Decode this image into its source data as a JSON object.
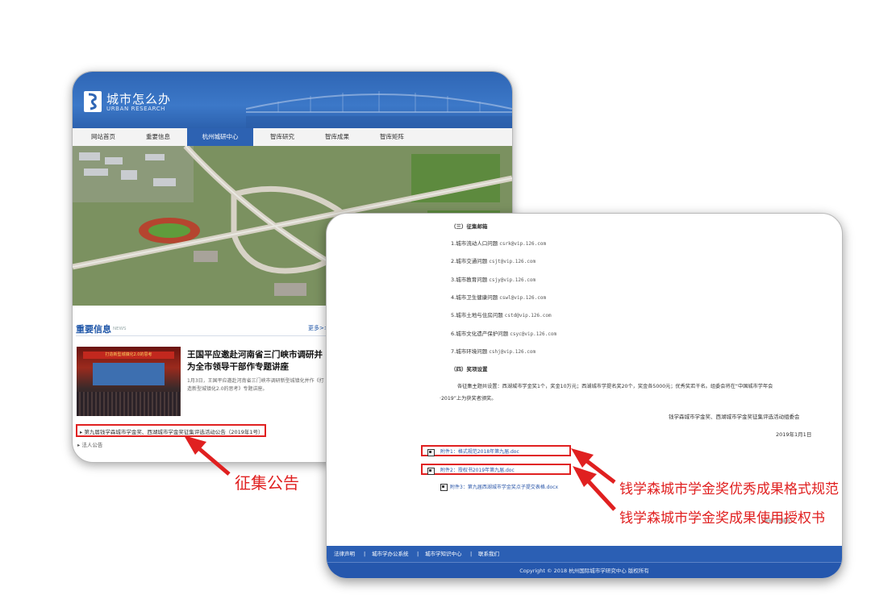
{
  "back_window": {
    "site": {
      "title": "城市怎么办",
      "subtitle": "URBAN RESEARCH"
    },
    "nav": [
      {
        "label": "网站首页",
        "active": false
      },
      {
        "label": "重要信息",
        "active": false
      },
      {
        "label": "杭州城研中心",
        "active": true
      },
      {
        "label": "智库研究",
        "active": false
      },
      {
        "label": "智库成果",
        "active": false
      },
      {
        "label": "智库矩阵",
        "active": false
      }
    ],
    "news": {
      "section_title": "重要信息",
      "section_en": "NEWS",
      "more": "更多>>",
      "headline": "王国平应邀赴河南省三门峡市调研并为全市领导干部作专题讲座",
      "summary": "1月3日，王国平应邀赴河南省三门峡市调研新型城镇化并作《打造新型城镇化2.0的思考》专题讲座。",
      "thumb_banner": "打造新型城镇化2.0的思考"
    },
    "notice_link": "▸ 第九届钱学森城市学金奖、西湖城市学金奖征集评选活动公告（2019年1号）",
    "legal_notice": "▸ 法人公告"
  },
  "front_window": {
    "mail_section_title": "（三）征集邮箱",
    "mail_items": [
      {
        "label": "1.城市流动人口问题",
        "email": "csrk@vip.126.com"
      },
      {
        "label": "2.城市交通问题",
        "email": "csjt@vip.126.com"
      },
      {
        "label": "3.城市教育问题",
        "email": "csjy@vip.126.com"
      },
      {
        "label": "4.城市卫生健康问题",
        "email": "cswl@vip.126.com"
      },
      {
        "label": "5.城市土地与住房问题",
        "email": "cstd@vip.126.com"
      },
      {
        "label": "6.城市文化遗产保护问题",
        "email": "csyc@vip.126.com"
      },
      {
        "label": "7.城市环境问题",
        "email": "cshj@vip.126.com"
      }
    ],
    "award_section_title": "（四）奖项设置",
    "award_text_1": "各征集主题共设置：西湖城市学金奖1个，奖金10万元；西湖城市学提名奖20个，奖金各5000元；优秀奖若干名。组委会将在“中国城市学年会",
    "award_text_2": "·2019”上为获奖者颁奖。",
    "signature": "钱学森城市学金奖、西湖城市学金奖征集评选活动组委会",
    "date": "2019年1月1日",
    "attachments": [
      "附件1：格式规范2018年第九届.doc",
      "附件2：授权书2019年第九届.doc",
      "附件3：第九届西湖城市学金奖点子提交表格.docx"
    ],
    "editor": "(编辑：孙瑞芳)",
    "footer_links": [
      "法律声明",
      "|",
      "城市学办公系统",
      "|",
      "城市学知识中心",
      "|",
      "联系我们"
    ],
    "copyright": "Copyright © 2018 杭州国际城市学研究中心 版权所有"
  },
  "annotations": {
    "notice": "征集公告",
    "format": "钱学森城市学金奖优秀成果格式规范",
    "authorization": "钱学森城市学金奖成果使用授权书",
    "color": "#e02020"
  },
  "colors": {
    "header_blue": "#2f66b5",
    "nav_active": "#2d62b2",
    "footer_blue": "#2b5fb4",
    "highlight_red": "#e02020"
  }
}
